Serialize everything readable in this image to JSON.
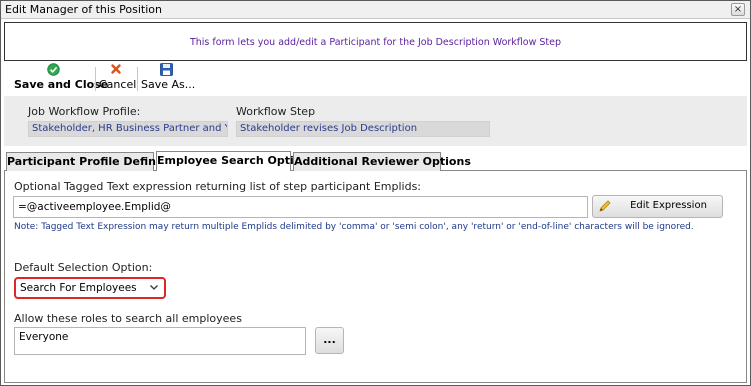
{
  "window": {
    "title": "Edit Manager of this Position",
    "close_glyph": "×"
  },
  "banner": {
    "text": "This form lets you add/edit a Participant for the Job Description Workflow Step"
  },
  "toolbar": {
    "save_close": {
      "label": "Save and Close",
      "icon": "check-circle-icon"
    },
    "cancel": {
      "label": "Cancel",
      "icon": "x-icon"
    },
    "save_as": {
      "label": "Save As...",
      "icon": "floppy-disk-icon"
    }
  },
  "profile": {
    "workflow_profile_label": "Job Workflow Profile:",
    "workflow_profile_value": "Stakeholder, HR Business Partner and You",
    "workflow_step_label": "Workflow Step",
    "workflow_step_value": "Stakeholder revises Job Description"
  },
  "tabs": [
    {
      "label": "Participant Profile Definition",
      "active": false
    },
    {
      "label": "Employee Search Options",
      "active": true
    },
    {
      "label": "Additional Reviewer Options",
      "active": false
    }
  ],
  "search_options": {
    "expression_label": "Optional Tagged Text expression returning list of step participant Emplids:",
    "expression_value": "=@activeemployee.Emplid@",
    "edit_expression_button": "Edit Expression",
    "note": "Note: Tagged Text Expression may return multiple Emplids delimited by 'comma' or 'semi colon', any 'return' or 'end-of-line' characters will be ignored.",
    "default_selection_label": "Default Selection Option:",
    "default_selection_value": "Search For Employees",
    "roles_label": "Allow these roles to search all employees",
    "roles_value": "Everyone",
    "roles_picker_button": "..."
  },
  "colors": {
    "banner_text": "#5a1ea0",
    "readonly_text": "#2a3a8c",
    "note_text": "#1e3a8a",
    "highlight_border": "#e0242a",
    "check_icon": "#2fa84f",
    "cancel_icon": "#d9531e",
    "floppy_icon": "#2b5fb8"
  }
}
